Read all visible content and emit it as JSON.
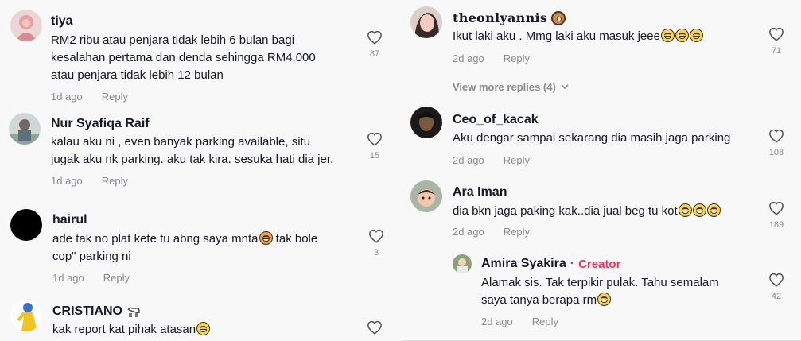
{
  "left_comments": [
    {
      "username": "tiya",
      "lines": [
        "RM2 ribu atau penjara tidak lebih 6 bulan bagi",
        "kesalahan pertama dan denda sehingga RM4,000",
        "atau penjara tidak lebih 12 bulan"
      ],
      "time": "1d ago",
      "reply_label": "Reply",
      "likes": "87"
    },
    {
      "username": "Nur Syafiqa Raif",
      "lines": [
        "kalau aku ni , even banyak parking available, situ",
        "jugak aku nk parking. aku tak kira. sesuka hati dia jer."
      ],
      "time": "1d ago",
      "reply_label": "Reply",
      "likes": "15"
    },
    {
      "username": "hairul",
      "line1_before": "ade tak no plat kete tu abng saya mnta",
      "line1_after": " tak bole",
      "line2": "cop\" parking ni",
      "time": "1d ago",
      "reply_label": "Reply",
      "likes": "3"
    },
    {
      "username": "CRISTIANO",
      "text": "kak report kat pihak atasan"
    }
  ],
  "right_comments": [
    {
      "username": "theonlyannis",
      "text": "Ikut laki aku . Mmg laki aku masuk jeee",
      "time": "2d ago",
      "reply_label": "Reply",
      "likes": "71"
    },
    {
      "view_more": "View more replies (4)"
    },
    {
      "username": "Ceo_of_kacak",
      "text": "Aku dengar sampai sekarang dia masih jaga parking",
      "time": "2d ago",
      "reply_label": "Reply",
      "likes": "108"
    },
    {
      "username": "Ara Iman",
      "text": "dia bkn jaga paking kak..dia jual beg tu kot",
      "time": "2d ago",
      "reply_label": "Reply",
      "likes": "189"
    },
    {
      "username": "Amira Syakira",
      "badge_separator": "·",
      "badge": "Creator",
      "lines": [
        "Alamak sis. Tak terpikir pulak. Tahu semalam",
        "saya tanya berapa rm"
      ],
      "time": "2d ago",
      "reply_label": "Reply",
      "likes": "42"
    }
  ],
  "icons": {
    "heart": "heart-outline-icon",
    "chevron": "chevron-down-icon",
    "emoji_laugh": "grinning-squinting-face-icon",
    "emoji_heart_eyes": "smiling-face-with-hearts-icon",
    "emoji_donut": "doughnut-icon",
    "emoji_goat": "goat-icon"
  },
  "colors": {
    "accent": "#fe2c55",
    "muted": "#8a8b91",
    "text": "#161823",
    "background": "#f8f8f8"
  }
}
